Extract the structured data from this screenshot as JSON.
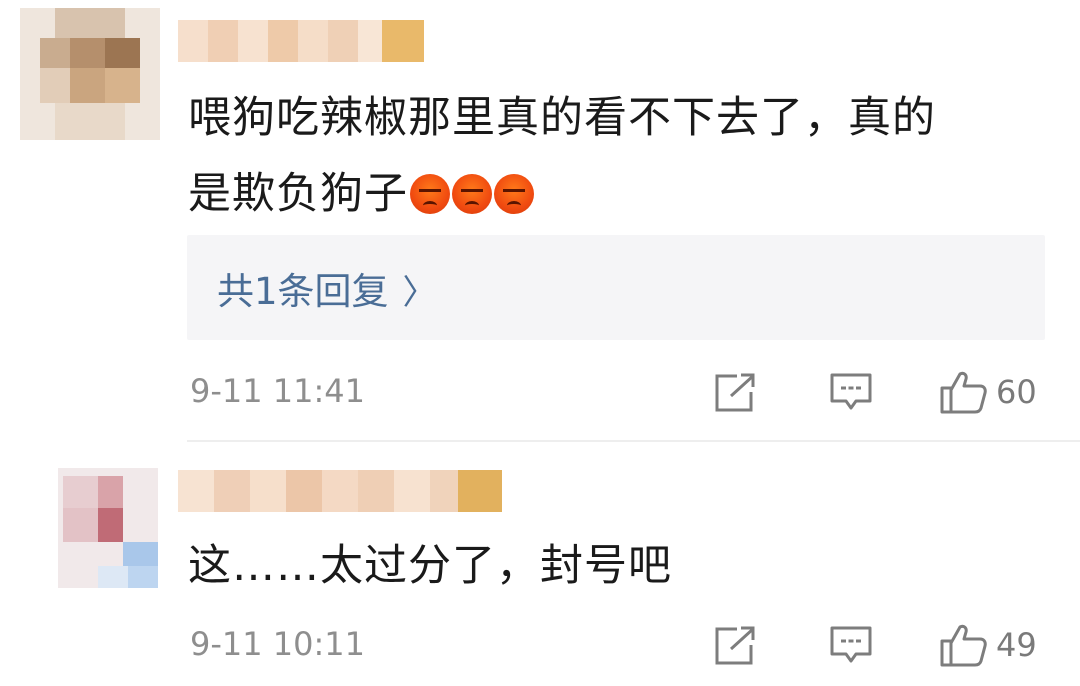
{
  "comments": [
    {
      "text_line1": "喂狗吃辣椒那里真的看不下去了，真的",
      "text_line2": "是欺负狗子",
      "emoji_name": "angry-face-emoji",
      "reply_link": "共1条回复",
      "reply_chevron": "〉",
      "timestamp": "9-11 11:41",
      "likes": "60"
    },
    {
      "text_line1": "这……太过分了，封号吧",
      "timestamp": "9-11 10:11",
      "likes": "49"
    }
  ],
  "icons": {
    "share": "share-icon",
    "comment": "comment-icon",
    "like": "thumbs-up-icon"
  },
  "colors": {
    "link": "#4a6d96",
    "meta": "#8e8e8e",
    "reply_bg": "#f5f5f7"
  }
}
